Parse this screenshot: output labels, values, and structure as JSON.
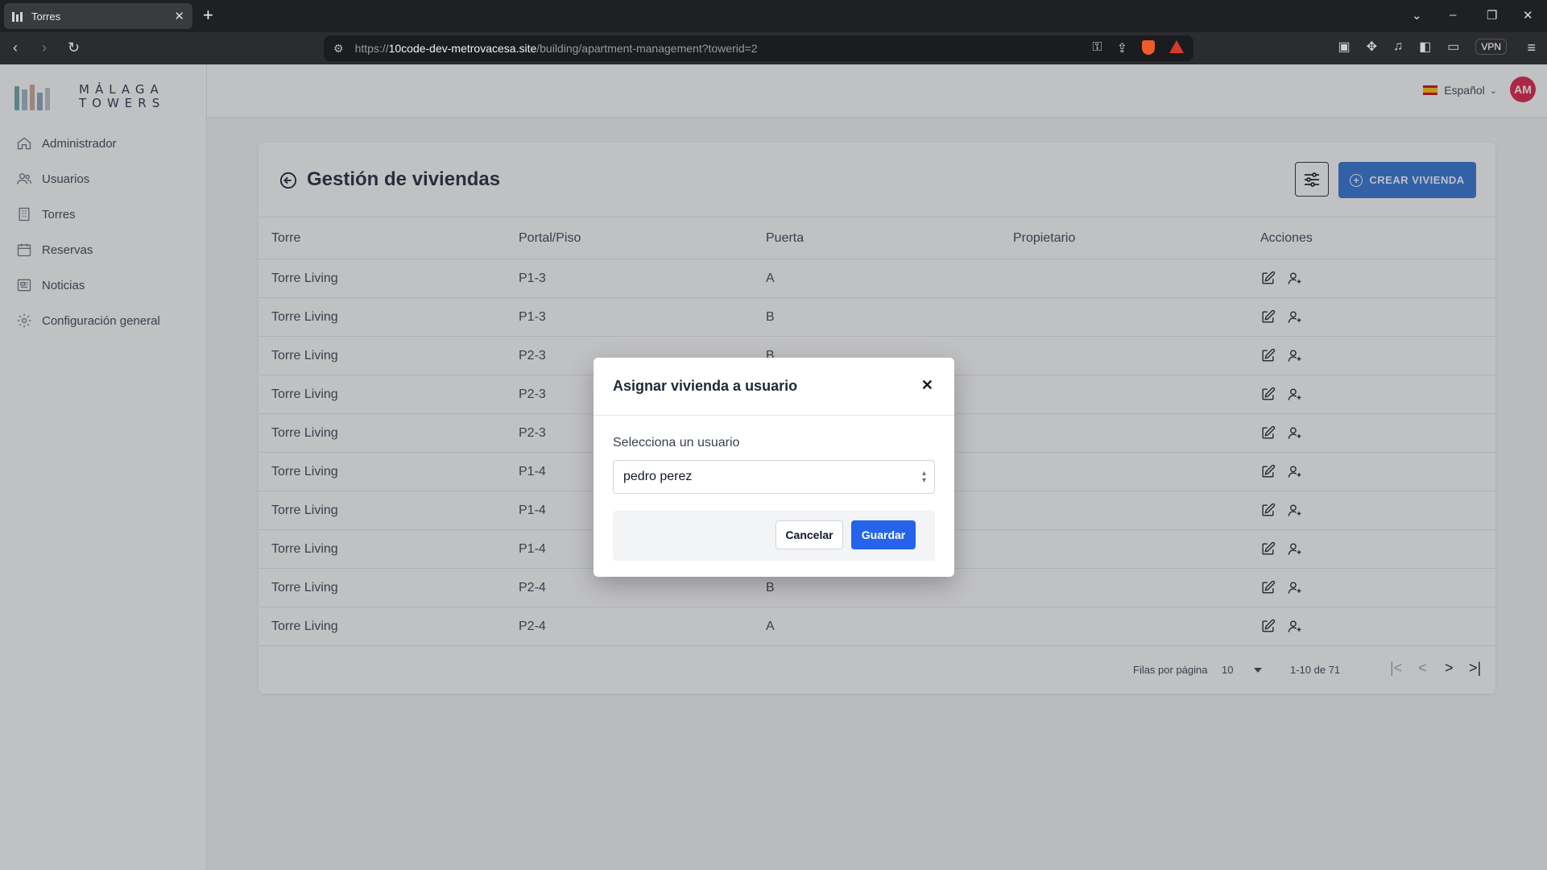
{
  "browser": {
    "tab_title": "Torres",
    "tab_close": "✕",
    "new_tab": "+",
    "url_scheme": "https://",
    "url_host": "10code-dev-metrovacesa.site",
    "url_path": "/building/apartment-management?towerid=2",
    "vpn_label": "VPN"
  },
  "app": {
    "logo_text_line1": "MÁLAGA",
    "logo_text_line2": "TOWERS",
    "sidebar": {
      "items": [
        {
          "label": "Administrador",
          "icon": "home-icon"
        },
        {
          "label": "Usuarios",
          "icon": "users-icon"
        },
        {
          "label": "Torres",
          "icon": "building-icon"
        },
        {
          "label": "Reservas",
          "icon": "calendar-icon"
        },
        {
          "label": "Noticias",
          "icon": "newspaper-icon"
        },
        {
          "label": "Configuración general",
          "icon": "gear-icon"
        }
      ]
    },
    "topbar": {
      "language": "Español",
      "avatar_initials": "AM"
    },
    "page": {
      "title": "Gestión de viviendas",
      "create_button": "CREAR VIVIENDA"
    },
    "table": {
      "columns": [
        "Torre",
        "Portal/Piso",
        "Puerta",
        "Propietario",
        "Acciones"
      ],
      "rows": [
        {
          "torre": "Torre Living",
          "portal": "P1-3",
          "puerta": "A",
          "propietario": ""
        },
        {
          "torre": "Torre Living",
          "portal": "P1-3",
          "puerta": "B",
          "propietario": ""
        },
        {
          "torre": "Torre Living",
          "portal": "P2-3",
          "puerta": "B",
          "propietario": ""
        },
        {
          "torre": "Torre Living",
          "portal": "P2-3",
          "puerta": "",
          "propietario": ""
        },
        {
          "torre": "Torre Living",
          "portal": "P2-3",
          "puerta": "",
          "propietario": ""
        },
        {
          "torre": "Torre Living",
          "portal": "P1-4",
          "puerta": "",
          "propietario": ""
        },
        {
          "torre": "Torre Living",
          "portal": "P1-4",
          "puerta": "",
          "propietario": ""
        },
        {
          "torre": "Torre Living",
          "portal": "P1-4",
          "puerta": "",
          "propietario": ""
        },
        {
          "torre": "Torre Living",
          "portal": "P2-4",
          "puerta": "B",
          "propietario": ""
        },
        {
          "torre": "Torre Living",
          "portal": "P2-4",
          "puerta": "A",
          "propietario": ""
        }
      ]
    },
    "pagination": {
      "rows_per_page_label": "Filas por página",
      "rows_per_page_value": "10",
      "range": "1-10 de 71",
      "first": "|<",
      "prev": "<",
      "next": ">",
      "last": ">|"
    },
    "modal": {
      "title": "Asignar vivienda a usuario",
      "close": "✕",
      "field_label": "Selecciona un usuario",
      "selected_user": "pedro perez",
      "cancel_label": "Cancelar",
      "save_label": "Guardar"
    },
    "colors": {
      "primary": "#2e72d8",
      "save": "#2563eb",
      "avatar": "#e11d48"
    }
  }
}
